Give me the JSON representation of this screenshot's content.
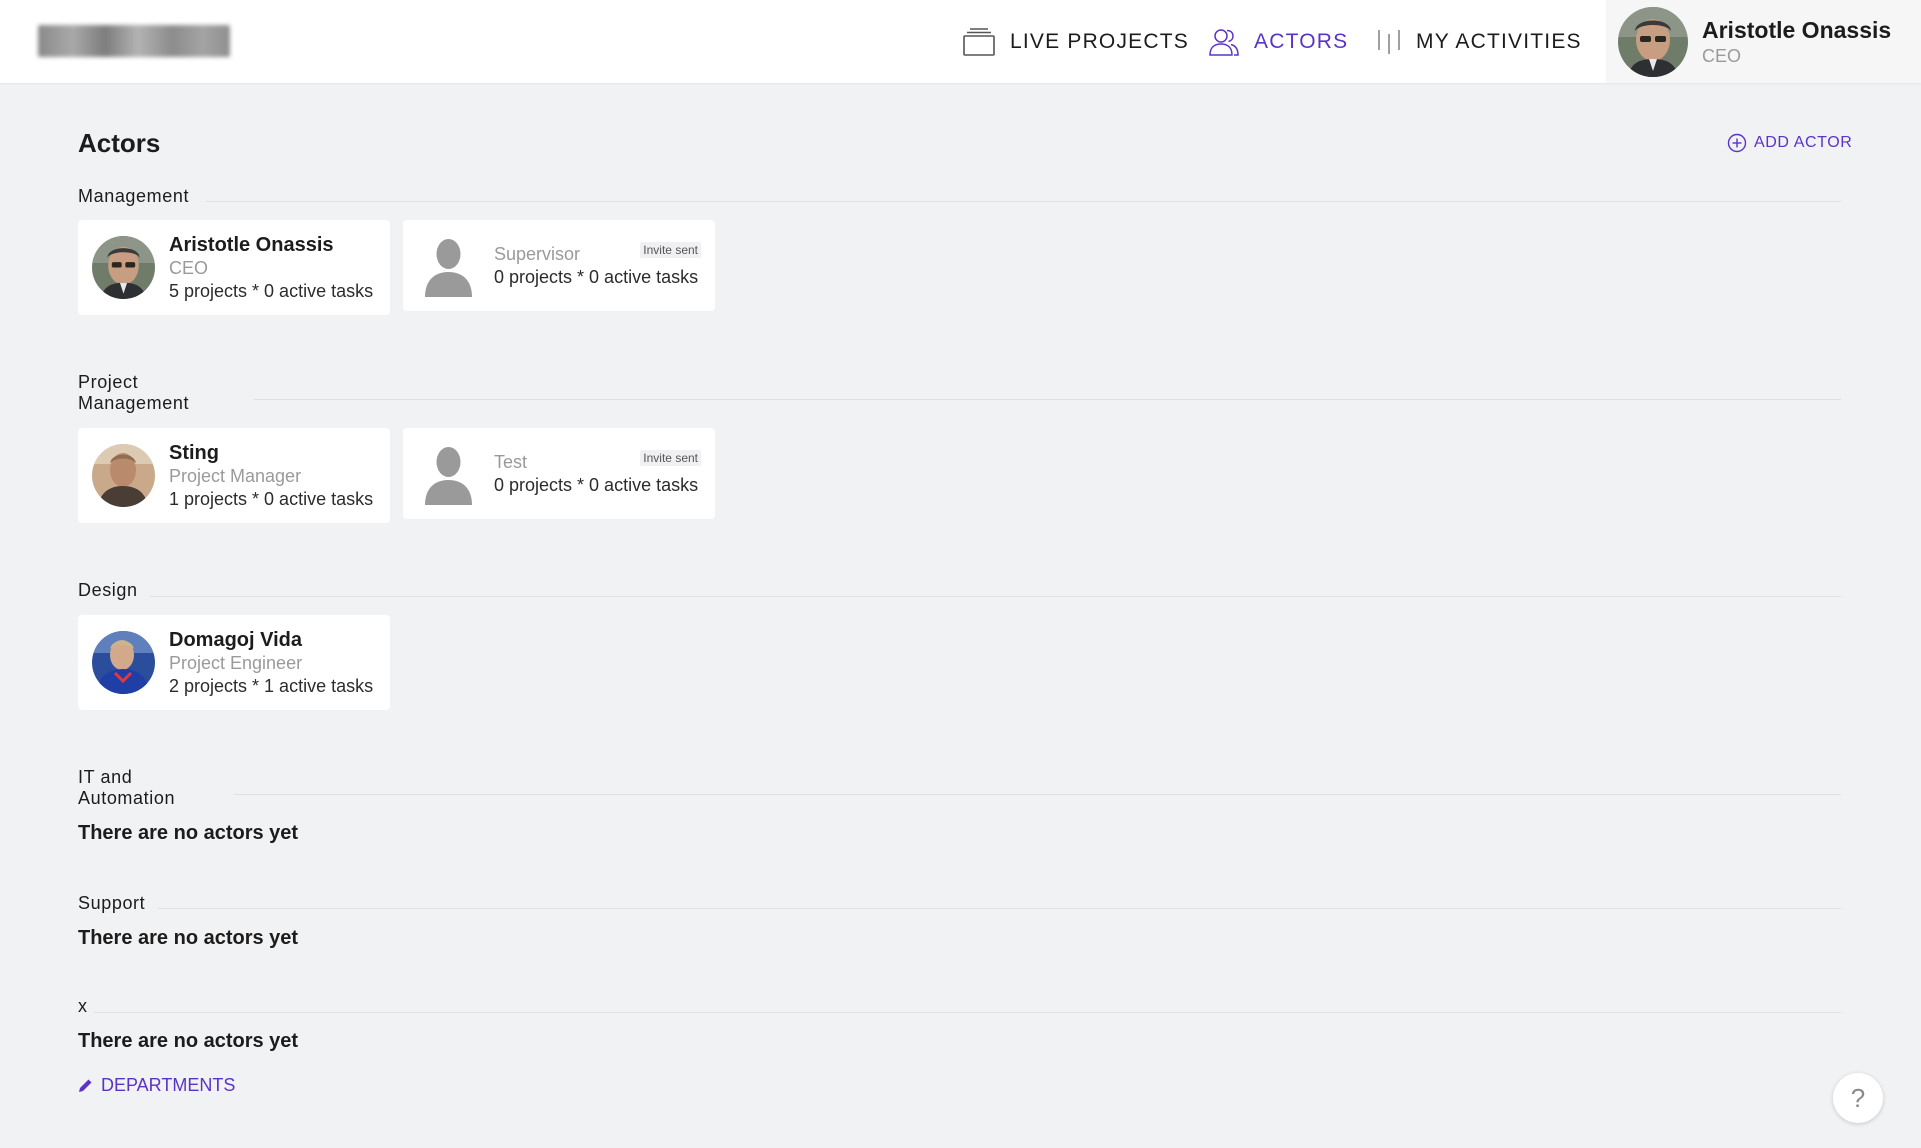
{
  "nav": {
    "live_projects": "LIVE PROJECTS",
    "actors": "ACTORS",
    "my_activities": "MY ACTIVITIES",
    "active_color": "#5b33c7"
  },
  "user": {
    "name": "Aristotle Onassis",
    "role": "CEO"
  },
  "page": {
    "title": "Actors",
    "add_actor": "ADD ACTOR"
  },
  "departments": [
    {
      "name": "Management",
      "actors": [
        {
          "name": "Aristotle Onassis",
          "role": "CEO",
          "stats": "5 projects * 0 active tasks"
        },
        {
          "role": "Supervisor",
          "stats": "0 projects * 0 active tasks",
          "badge": "Invite sent"
        }
      ]
    },
    {
      "name": "Project Management",
      "name_lines": [
        "Project",
        "Management"
      ],
      "actors": [
        {
          "name": "Sting",
          "role": "Project Manager",
          "stats": "1 projects * 0 active tasks"
        },
        {
          "role": "Test",
          "stats": "0 projects * 0 active tasks",
          "badge": "Invite sent"
        }
      ]
    },
    {
      "name": "Design",
      "actors": [
        {
          "name": "Domagoj Vida",
          "role": "Project Engineer",
          "stats": "2 projects * 1 active tasks"
        }
      ]
    },
    {
      "name": "IT and Automation",
      "name_lines": [
        "IT and",
        "Automation"
      ],
      "empty": "There are no actors yet"
    },
    {
      "name": "Support",
      "empty": "There are no actors yet"
    },
    {
      "name": "x",
      "empty": "There are no actors yet"
    }
  ],
  "footer": {
    "departments_link": "DEPARTMENTS",
    "help": "?"
  },
  "icons": {
    "live_projects": "stack-icon",
    "actors": "people-icon",
    "my_activities": "bars-icon",
    "add_actor": "plus-circle-icon",
    "departments": "pencil-icon",
    "help": "question-icon",
    "avatar_placeholder": "person-silhouette-icon"
  }
}
